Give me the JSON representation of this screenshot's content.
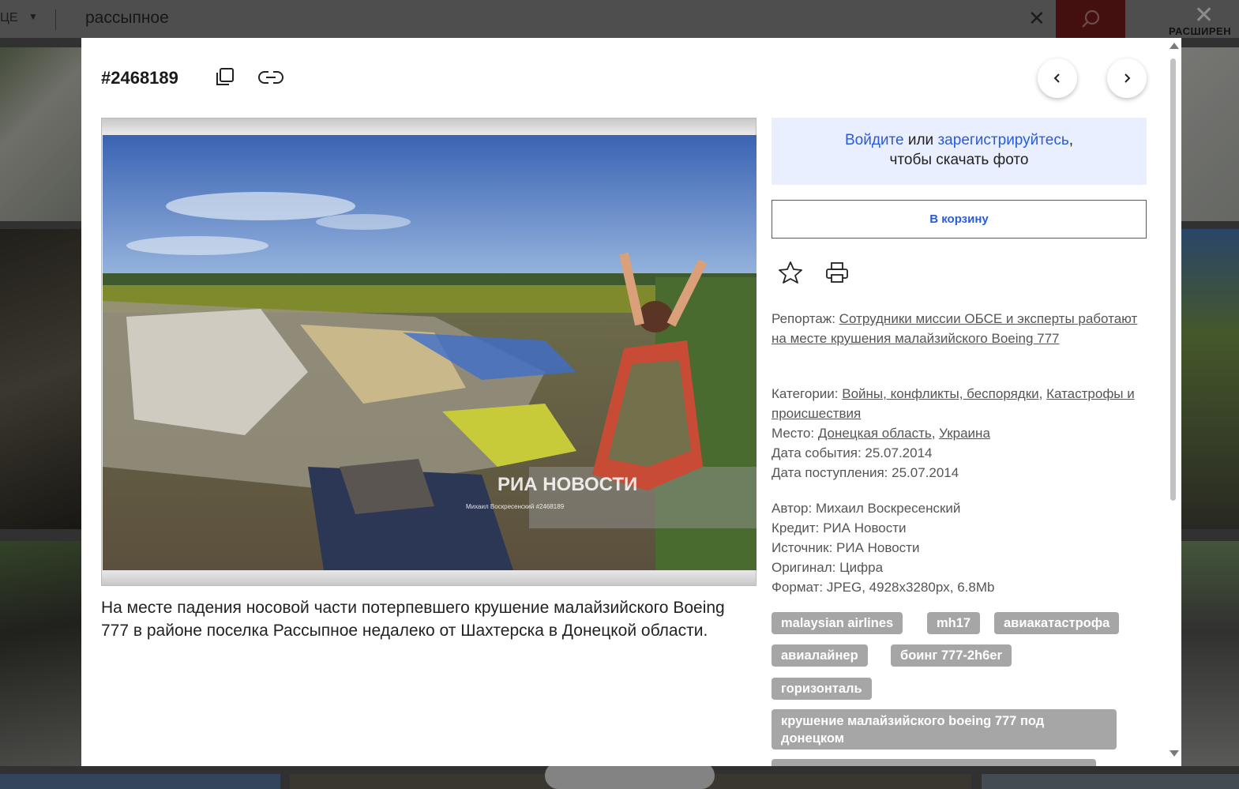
{
  "search": {
    "filter_label": "ЦЕ",
    "query": "рассыпное",
    "advanced_label": "РАСШИРЕН"
  },
  "modal": {
    "photo_id": "#2468189",
    "login": {
      "login_link": "Войдите",
      "or": "или",
      "register_link": "зарегистрируйтесь",
      "comma": ",",
      "suffix": "чтобы скачать фото"
    },
    "cart_button": "В корзину",
    "caption": "На месте падения носовой части потерпевшего крушение малайзийского Boeing 777 в районе поселка Рассыпное недалеко от Шахтерска в Донецкой области.",
    "watermark": {
      "brand": "РИА НОВОСТИ",
      "credit_line": "Михаил Воскресенский #2468189"
    },
    "meta": {
      "report_label": "Репортаж:",
      "report_link": "Сотрудники миссии ОБСЕ и эксперты работают на месте крушения малайзийского Boeing 777",
      "categories_label": "Категории:",
      "category_1": "Войны, конфликты, беспорядки",
      "category_2": "Катастрофы и происшествия",
      "place_label": "Место:",
      "place_1": "Донецкая область",
      "place_2": "Украина",
      "event_date": "Дата события: 25.07.2014",
      "received_date": "Дата поступления: 25.07.2014",
      "author": "Автор: Михаил Воскресенский",
      "credit": "Кредит: РИА Новости",
      "source": "Источник: РИА Новости",
      "original": "Оригинал: Цифра",
      "format": "Формат: JPEG, 4928x3280px, 6.8Mb"
    },
    "tags": [
      "malaysian airlines",
      "mh17",
      "авиакатастрофа",
      "авиалайнер",
      "боинг 777-2h6er",
      "горизонталь",
      "крушение малайзийского boeing 777 под донецком"
    ]
  },
  "colors": {
    "accent": "#2a5bd7",
    "tag_bg": "#a6a6a6",
    "login_bg": "#e9efff",
    "search_button": "#7a1d1d"
  }
}
